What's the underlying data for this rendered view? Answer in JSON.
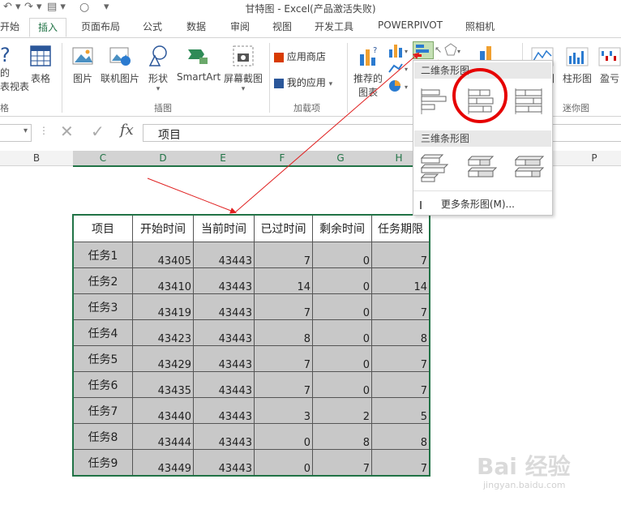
{
  "window": {
    "title": "甘特图 - Excel(产品激活失败)"
  },
  "tabs": [
    {
      "label": "开始",
      "active": false
    },
    {
      "label": "插入",
      "active": true
    },
    {
      "label": "页面布局",
      "active": false
    },
    {
      "label": "公式",
      "active": false
    },
    {
      "label": "数据",
      "active": false
    },
    {
      "label": "审阅",
      "active": false
    },
    {
      "label": "视图",
      "active": false
    },
    {
      "label": "开发工具",
      "active": false
    },
    {
      "label": "POWERPIVOT",
      "active": false
    },
    {
      "label": "照相机",
      "active": false
    }
  ],
  "ribbon": {
    "pivot_partial_1": "?",
    "pivot_partial_2": "的",
    "pivot_partial_3": "表视表",
    "table_label": "表格",
    "table_group_partial": "格",
    "picture_label": "图片",
    "online_picture_label": "联机图片",
    "shapes_label": "形状",
    "smartart_label": "SmartArt",
    "screenshot_label": "屏幕截图",
    "illustrations_group": "插图",
    "app_store_label": "应用商店",
    "my_apps_label": "我的应用",
    "addins_group": "加载项",
    "recommended_charts_label_1": "推荐的",
    "recommended_charts_label_2": "图表",
    "line_sparkline_partial": "图",
    "column_sparkline_label": "柱形图",
    "winloss_partial": "盈亏",
    "sparklines_group": "迷你图"
  },
  "formula_bar": {
    "name_box": "",
    "fx": "fx",
    "value": "项目"
  },
  "columns": [
    {
      "label": "B",
      "selected": false
    },
    {
      "label": "C",
      "selected": true
    },
    {
      "label": "D",
      "selected": true
    },
    {
      "label": "E",
      "selected": true
    },
    {
      "label": "F",
      "selected": true
    },
    {
      "label": "G",
      "selected": true
    },
    {
      "label": "H",
      "selected": true
    },
    {
      "label": "P",
      "selected": false
    }
  ],
  "table": {
    "headers": [
      "项目",
      "开始时间",
      "当前时间",
      "已过时间",
      "剩余时间",
      "任务期限"
    ],
    "rows": [
      [
        "任务1",
        "43405",
        "43443",
        "7",
        "0",
        "7"
      ],
      [
        "任务2",
        "43410",
        "43443",
        "14",
        "0",
        "14"
      ],
      [
        "任务3",
        "43419",
        "43443",
        "7",
        "0",
        "7"
      ],
      [
        "任务4",
        "43423",
        "43443",
        "8",
        "0",
        "8"
      ],
      [
        "任务5",
        "43429",
        "43443",
        "7",
        "0",
        "7"
      ],
      [
        "任务6",
        "43435",
        "43443",
        "7",
        "0",
        "7"
      ],
      [
        "任务7",
        "43440",
        "43443",
        "3",
        "2",
        "5"
      ],
      [
        "任务8",
        "43444",
        "43443",
        "0",
        "8",
        "8"
      ],
      [
        "任务9",
        "43449",
        "43443",
        "0",
        "7",
        "7"
      ]
    ]
  },
  "dropdown": {
    "section_2d": "二维条形图",
    "section_3d": "三维条形图",
    "more_label": "更多条形图(M)..."
  },
  "watermark": {
    "brand": "Bai 经验",
    "url": "jingyan.baidu.com"
  },
  "colors": {
    "accent": "#217346",
    "selection_fill": "#c8c8c8",
    "highlight_circle": "#e60000",
    "arrow": "#e02020"
  }
}
